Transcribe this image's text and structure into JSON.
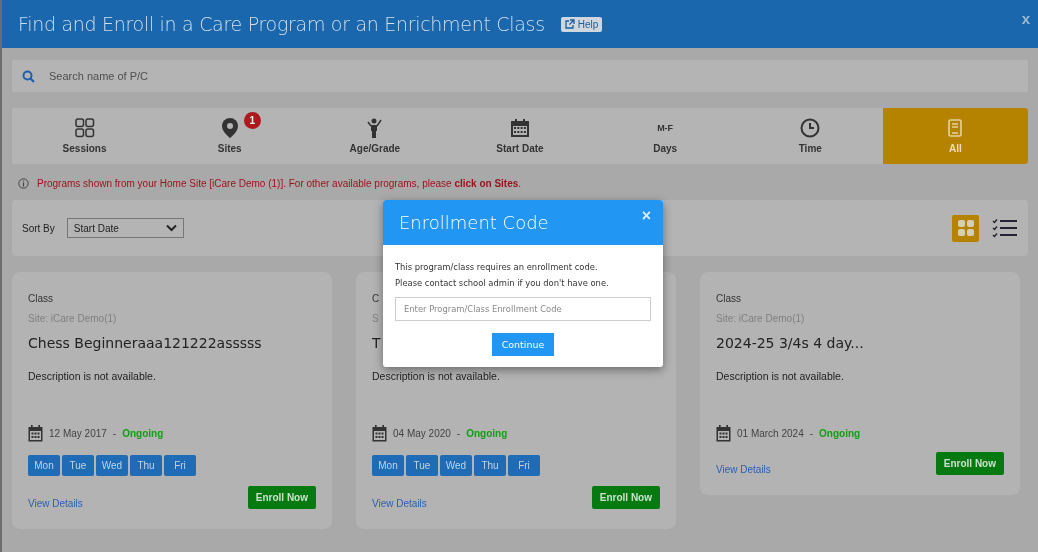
{
  "window": {
    "title": "Find and Enroll in a Care Program or an Enrichment Class",
    "help": "Help",
    "close": "x"
  },
  "search": {
    "placeholder": "Search name of P/C"
  },
  "filters": [
    {
      "kind": "sessions",
      "label": "Sessions",
      "selected": false
    },
    {
      "kind": "sites",
      "label": "Sites",
      "badge": "1",
      "selected": false
    },
    {
      "kind": "age",
      "label": "Age/Grade",
      "selected": false
    },
    {
      "kind": "date",
      "label": "Start Date",
      "selected": false
    },
    {
      "kind": "days",
      "label": "Days",
      "abbr": "M-F",
      "selected": false
    },
    {
      "kind": "time",
      "label": "Time",
      "selected": false
    },
    {
      "kind": "all",
      "label": "All",
      "selected": true
    }
  ],
  "notice": "Programs shown from your Home Site [iCare Demo (1)]. For other available programs, please **click on Sites**.",
  "sort": {
    "label": "Sort By",
    "value": "Start Date"
  },
  "views": [
    {
      "kind": "grid",
      "selected": true
    },
    {
      "kind": "list",
      "selected": false
    }
  ],
  "cards": [
    {
      "type": "Class",
      "site": "Site: iCare Demo(1)",
      "title": "Chess Beginneraaa121222asssss",
      "description": "Description is not available.",
      "date": "12 May 2017",
      "separator": "-",
      "status": "Ongoing",
      "days": [
        "Mon",
        "Tue",
        "Wed",
        "Thu",
        "Fri"
      ],
      "details": "View Details",
      "action": "Enroll Now"
    },
    {
      "type": "C",
      "site": "S",
      "title": "T",
      "description": "Description is not available.",
      "date": "04 May 2020",
      "separator": "-",
      "status": "Ongoing",
      "days": [
        "Mon",
        "Tue",
        "Wed",
        "Thu",
        "Fri"
      ],
      "details": "View Details",
      "action": "Enroll Now"
    },
    {
      "type": "Class",
      "site": "Site: iCare Demo(1)",
      "title": "2024-25 3/4s 4 day...",
      "description": "Description is not available.",
      "date": "01 March 2024",
      "separator": "-",
      "status": "Ongoing",
      "details": "View Details",
      "action": "Enroll Now"
    }
  ],
  "modal": {
    "title": "Enrollment Code",
    "close": "×",
    "lines": [
      "This program/class requires an enrollment code.",
      "Please contact school admin if you don't have one."
    ],
    "placeholder": "Enter Program/Class Enrollment Code",
    "button": "Continue"
  }
}
